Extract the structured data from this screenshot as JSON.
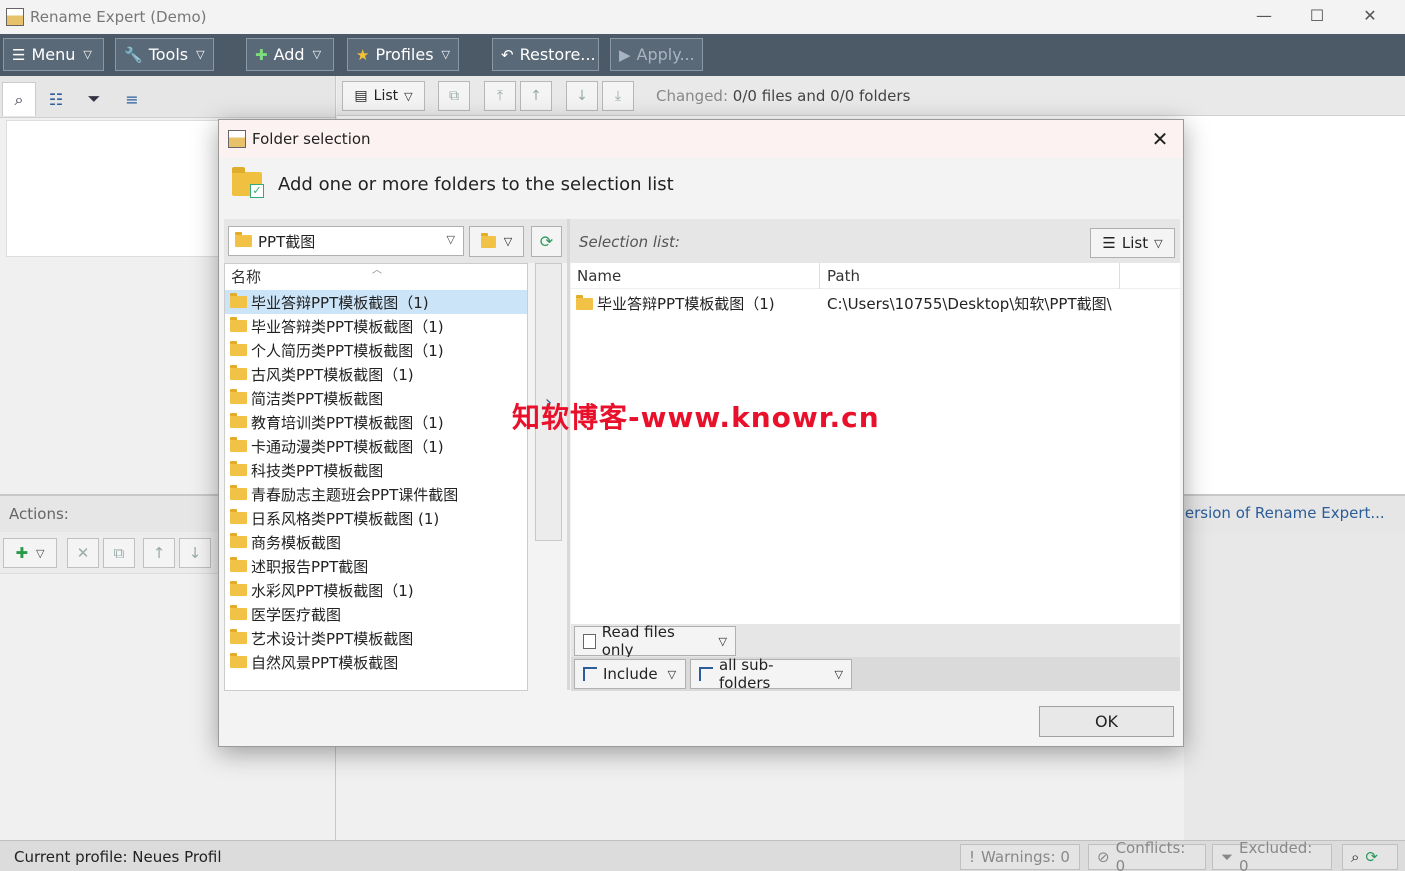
{
  "window": {
    "title": "Rename Expert (Demo)",
    "minimize": "—",
    "maximize": "☐",
    "close": "✕"
  },
  "toolbar": {
    "menu": "Menu",
    "tools": "Tools",
    "add": "Add",
    "profiles": "Profiles",
    "restore": "Restore...",
    "apply": "Apply..."
  },
  "main": {
    "list_label": "List",
    "changed_label": "Changed:",
    "changed_value": "0/0 files and 0/0 folders",
    "version_link": "version of Rename Expert..."
  },
  "actions": {
    "label": "Actions:"
  },
  "status": {
    "profile": "Current profile: Neues Profil",
    "warnings": "Warnings: 0",
    "conflicts": "Conflicts: 0",
    "excluded": "Excluded: 0"
  },
  "dialog": {
    "title": "Folder selection",
    "header": "Add one or more folders to the selection list",
    "current_folder": "PPT截图",
    "tree_header": "名称",
    "tree_items": [
      "毕业答辩PPT模板截图（1)",
      "毕业答辩类PPT模板截图（1)",
      "个人简历类PPT模板截图（1)",
      "古风类PPT模板截图（1)",
      "简洁类PPT模板截图",
      "教育培训类PPT模板截图（1)",
      "卡通动漫类PPT模板截图（1)",
      "科技类PPT模板截图",
      "青春励志主题班会PPT课件截图",
      "日系风格类PPT模板截图 (1)",
      "商务模板截图",
      "述职报告PPT截图",
      "水彩风PPT模板截图（1)",
      "医学医疗截图",
      "艺术设计类PPT模板截图",
      "自然风景PPT模板截图"
    ],
    "selection_label": "Selection list:",
    "list_view": "List",
    "col_name": "Name",
    "col_path": "Path",
    "selected": [
      {
        "name": "毕业答辩PPT模板截图（1)",
        "path": "C:\\Users\\10755\\Desktop\\知软\\PPT截图\\"
      }
    ],
    "read_files": "Read files only",
    "include": "Include",
    "subfolders": "all sub-folders",
    "ok": "OK"
  },
  "watermark": "知软博客-www.knowr.cn"
}
